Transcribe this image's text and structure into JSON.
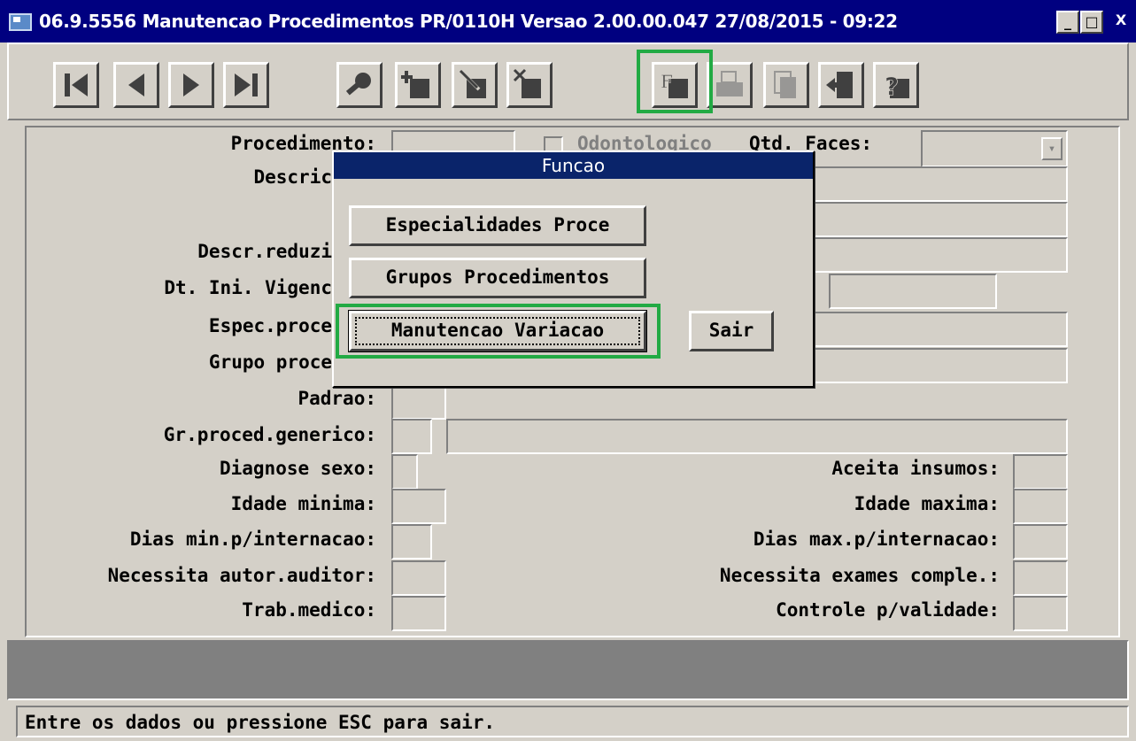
{
  "window": {
    "title": "06.9.5556 Manutencao  Procedimentos PR/0110H Versao 2.00.00.047 27/08/2015 - 09:22",
    "controls": {
      "minimize": "_",
      "maximize": "□",
      "close": "X"
    }
  },
  "toolbar": {
    "buttons": [
      {
        "name": "first-record",
        "icon": "first-icon"
      },
      {
        "name": "previous-record",
        "icon": "previous-icon"
      },
      {
        "name": "next-record",
        "icon": "next-icon"
      },
      {
        "name": "last-record",
        "icon": "last-icon"
      },
      {
        "name": "search",
        "icon": "search-key-icon"
      },
      {
        "name": "add",
        "icon": "add-icon"
      },
      {
        "name": "edit",
        "icon": "edit-icon"
      },
      {
        "name": "delete",
        "icon": "delete-icon"
      },
      {
        "name": "function",
        "icon": "function-icon",
        "label": "F",
        "highlighted": true
      },
      {
        "name": "print",
        "icon": "print-icon",
        "disabled": true
      },
      {
        "name": "copy",
        "icon": "copy-icon",
        "disabled": true
      },
      {
        "name": "exit",
        "icon": "exit-door-icon"
      },
      {
        "name": "help",
        "icon": "help-icon",
        "label": "?"
      }
    ]
  },
  "form": {
    "procedimento": "Procedimento:",
    "odontologico": "Odontologico",
    "qtd_faces": "Qtd. Faces:",
    "descricao": "Descric",
    "descr_reduzida": "Descr.reduzi",
    "dt_ini_vigencia": "Dt. Ini. Vigenc",
    "espec_proced": "Espec.proce",
    "grupo_proced": "Grupo proce",
    "padrao": "Padrao:",
    "gr_proced_generico": "Gr.proced.generico:",
    "diagnose_sexo": "Diagnose sexo:",
    "aceita_insumos": "Aceita insumos:",
    "idade_minima": "Idade minima:",
    "idade_maxima": "Idade maxima:",
    "dias_min": "Dias min.p/internacao:",
    "dias_max": "Dias max.p/internacao:",
    "necessita_autor": "Necessita autor.auditor:",
    "necessita_exames": "Necessita exames comple.:",
    "trab_medico": "Trab.medico:",
    "controle_validade": "Controle p/validade:"
  },
  "dialog": {
    "title": "Funcao",
    "buttons": {
      "especialidades": "Especialidades Proce",
      "grupos": "Grupos Procedimentos",
      "manutencao_variacao": "Manutencao Variacao",
      "sair": "Sair"
    }
  },
  "status": {
    "message": "Entre os dados ou pressione ESC para sair."
  },
  "colors": {
    "highlight": "#22aa44",
    "title_bar": "#000080",
    "dialog_title": "#0a246a",
    "face": "#d4d0c8"
  }
}
